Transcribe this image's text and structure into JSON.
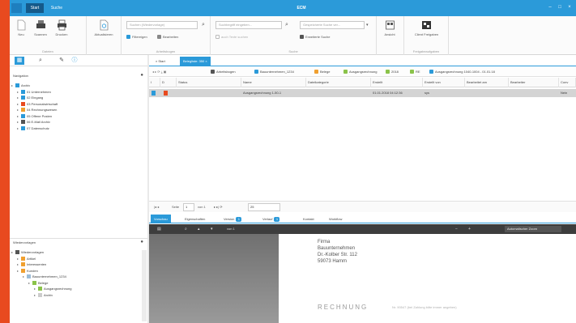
{
  "titlebar": {
    "tab_start": "Start",
    "tab_other": "Suche",
    "app_title": "ECM"
  },
  "ribbon": {
    "buttons": {
      "new": "Neu",
      "scan": "Scannen",
      "print": "Drucken",
      "attachment": "Aktualisieren",
      "client": "Client Freigaben"
    },
    "small_buttons": {
      "filter": "Filtereigen",
      "edit": "Bearbeiten",
      "extended_search": "Erweiterte Suche",
      "view": "Ansicht"
    },
    "fields": {
      "search": "Suchen (Wiedervorlage)",
      "fulltext": "Suchbegriff eingeben...",
      "saved_search": "Gespeicherte Suche ver...",
      "checkbox_text": "auch Texte suchen"
    },
    "group_labels": [
      "Dateien",
      "Arbeitsbogen",
      "Suche",
      "Freigabeaufgaben"
    ]
  },
  "left_panel": {
    "navigation_title": "Navigation",
    "tree": [
      {
        "label": "Archiv",
        "level": 0,
        "color": "#2b9ad9"
      },
      {
        "label": "01 Unternehmen",
        "level": 1,
        "color": "#2b9ad9"
      },
      {
        "label": "02 Eingang",
        "level": 1,
        "color": "#2b9ad9"
      },
      {
        "label": "03 Personalwirtschaft",
        "level": 1,
        "color": "#e84a1f"
      },
      {
        "label": "04 Rechnungswesen",
        "level": 1,
        "color": "#f0a030"
      },
      {
        "label": "05 Offene Posten",
        "level": 1,
        "color": "#2b9ad9"
      },
      {
        "label": "06 E-Mail Archiv",
        "level": 1,
        "color": "#555555"
      },
      {
        "label": "07 Datenschutz",
        "level": 1,
        "color": "#2b9ad9"
      }
    ],
    "wiedervorlage_title": "Wiedervorlagen",
    "tree2": [
      {
        "label": "Wiedervorlagen",
        "level": 0,
        "color": "#555555"
      },
      {
        "label": "Artikel",
        "level": 1,
        "color": "#f0a030"
      },
      {
        "label": "Interessenten",
        "level": 1,
        "color": "#f0a030"
      },
      {
        "label": "Kunden",
        "level": 1,
        "color": "#f0a030"
      },
      {
        "label": "Bauunternehmen_1234",
        "level": 2,
        "color": "#9bbcd8"
      },
      {
        "label": "Belege",
        "level": 3,
        "color": "#8bc34a"
      },
      {
        "label": "Ausgangsrechnung",
        "level": 4,
        "color": "#8bc34a"
      },
      {
        "label": "Archiv",
        "level": 4,
        "color": "#cccccc"
      }
    ]
  },
  "doc_tabs": {
    "start": "Start",
    "result": "Belegliste: 350"
  },
  "toolbar2": {
    "items": [
      "Arbeitsbogen",
      "Bauunternehmen_1234",
      "Belege",
      "Ausgangsrechnung",
      "2018",
      "RE",
      "Ausgangsrechnung 1040-1004 - 01.01.18"
    ]
  },
  "grid": {
    "columns": [
      "I",
      "D",
      "Status",
      "Name",
      "Dateikategorie",
      "Erstellt",
      "Erstellt von",
      "Bearbeitet am",
      "Bearbeiter",
      "Conv"
    ],
    "row": {
      "status": "",
      "name": "Ausgangsrechnung 1-50-1",
      "category": "",
      "created": "01.01.2018 04:12:36",
      "created_by": "sys",
      "edited_on": "",
      "editor": "",
      "conv": "Nein"
    }
  },
  "pager": {
    "page_label": "Seite",
    "page_value": "1",
    "of_label": "von 1",
    "size_value": "25"
  },
  "bottom_tabs": {
    "preview": "Vorschau",
    "properties": "Eigenschaften",
    "versions": "Version",
    "versions_count": "1",
    "revisions": "Verlauf",
    "revisions_count": "1",
    "contact": "Kontakt",
    "workflow": "Workflow"
  },
  "preview": {
    "page_indicator": "von 1",
    "zoom_select": "Automatischer Zoom",
    "address_lines": [
      "Firma",
      "Bauunternehmen",
      "Dr.-Kolber Str. 112",
      "59073 Hamm"
    ],
    "rechnung": "RECHNUNG",
    "rechnung_sub": "Nr. 90547 (bei Zahlung bitte immer angeben)"
  }
}
